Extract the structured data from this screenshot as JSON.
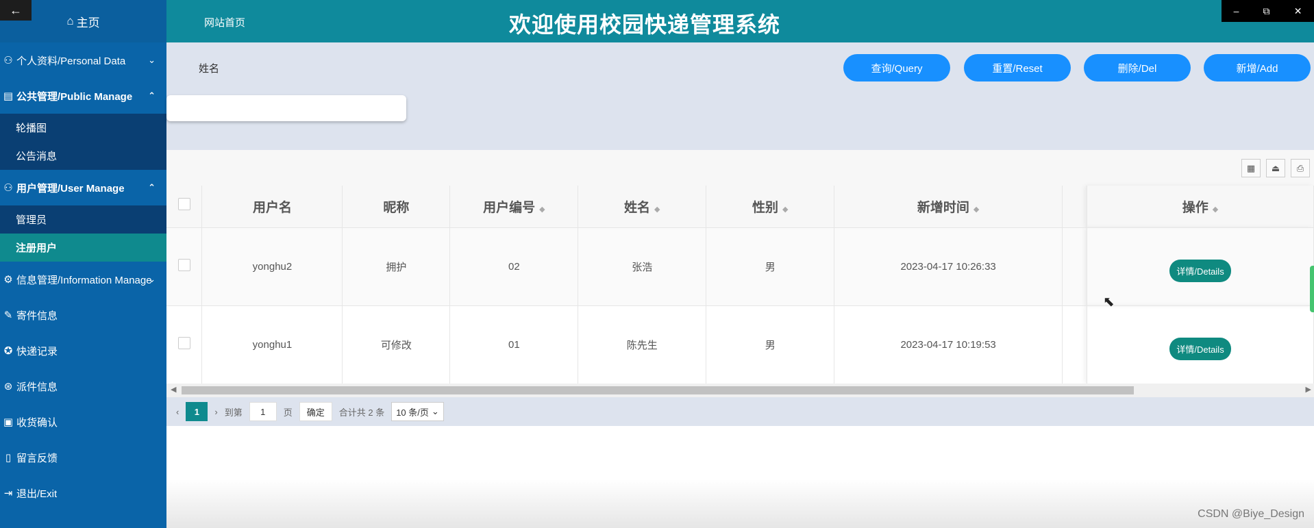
{
  "window": {
    "back": "←",
    "min": "–",
    "restore": "⧉",
    "close": "✕"
  },
  "sidebar": {
    "home": "主页",
    "items": [
      {
        "label": "个人资料/Personal Data",
        "icon": "user-icon",
        "chevron": "⌄"
      },
      {
        "label": "公共管理/Public Manage",
        "icon": "message-icon",
        "chevron": "⌃",
        "sub": [
          "轮播图",
          "公告消息"
        ]
      },
      {
        "label": "用户管理/User Manage",
        "icon": "users-icon",
        "chevron": "⌃",
        "sub": [
          "管理员",
          "注册用户"
        ]
      },
      {
        "label": "信息管理/Information Manage",
        "icon": "gear-icon",
        "chevron": "⌄"
      },
      {
        "label": "寄件信息",
        "icon": "pen-icon"
      },
      {
        "label": "快递记录",
        "icon": "badge-icon"
      },
      {
        "label": "派件信息",
        "icon": "dots-icon"
      },
      {
        "label": "收货确认",
        "icon": "calendar-icon"
      },
      {
        "label": "留言反馈",
        "icon": "book-icon"
      },
      {
        "label": "退出/Exit",
        "icon": "exit-icon"
      }
    ]
  },
  "header": {
    "home_link": "网站首页",
    "title": "欢迎使用校园快递管理系统"
  },
  "search": {
    "name_label": "姓名",
    "name_value": ""
  },
  "buttons": {
    "query": "查询/Query",
    "reset": "重置/Reset",
    "delete": "删除/Del",
    "add": "新增/Add"
  },
  "table": {
    "headers": [
      "用户名",
      "昵称",
      "用户编号",
      "姓名",
      "性别",
      "新增时间",
      "操作"
    ],
    "rows": [
      {
        "username": "yonghu2",
        "nickname": "拥护",
        "number": "02",
        "name": "张浩",
        "gender": "男",
        "time": "2023-04-17 10:26:33",
        "action": "详情/Details"
      },
      {
        "username": "yonghu1",
        "nickname": "可修改",
        "number": "01",
        "name": "陈先生",
        "gender": "男",
        "time": "2023-04-17 10:19:53",
        "action": "详情/Details"
      }
    ]
  },
  "pager": {
    "current": "1",
    "goto_label": "到第",
    "goto_value": "1",
    "page_unit": "页",
    "confirm": "确定",
    "total": "合计共 2 条",
    "page_size": "10 条/页"
  },
  "watermark": "CSDN @Biye_Design"
}
